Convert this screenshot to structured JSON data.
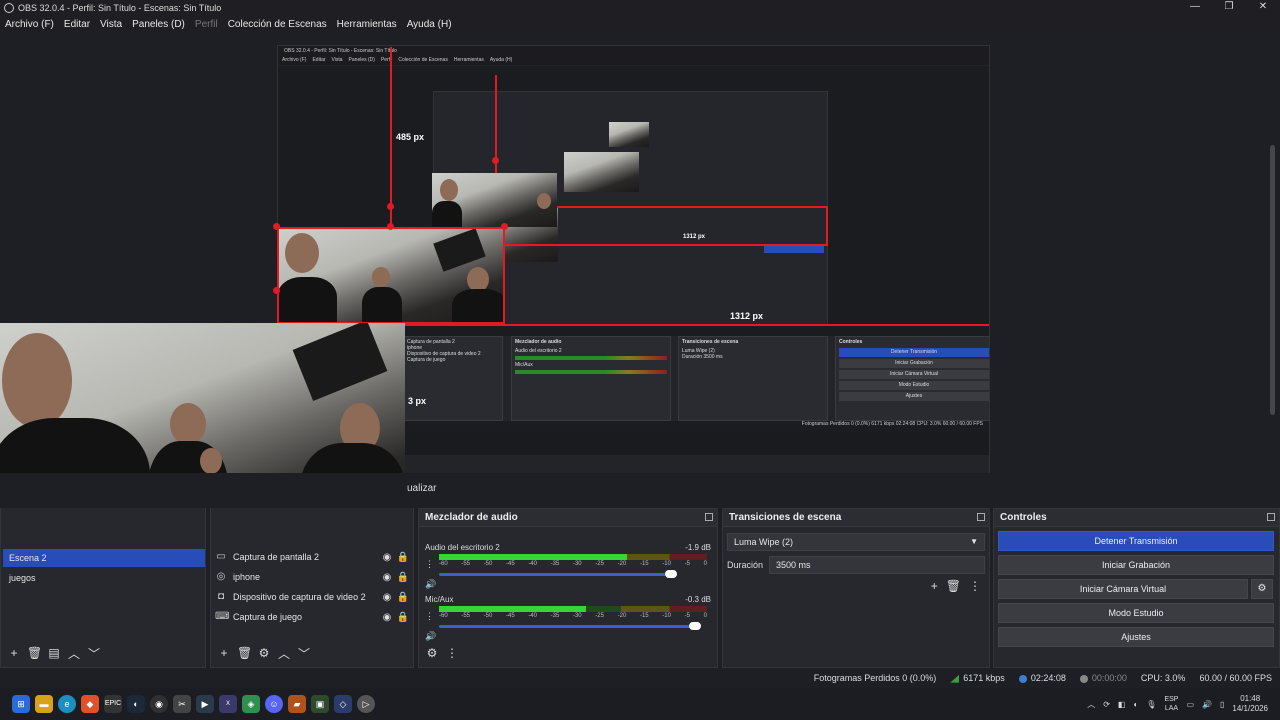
{
  "window": {
    "title": "OBS 32.0.4 - Perfil: Sin Título - Escenas: Sin Título",
    "minimize": "—",
    "maximize": "❐",
    "close": "✕"
  },
  "menu": {
    "archivo": "Archivo (F)",
    "editar": "Editar",
    "vista": "Vista",
    "paneles": "Paneles (D)",
    "perfil": "Perfil",
    "coleccion": "Colección de Escenas",
    "herramientas": "Herramientas",
    "ayuda": "Ayuda (H)"
  },
  "preview": {
    "height_label": "485 px",
    "width_label": "1312 px",
    "width_label_2": "1312 px",
    "partial_label": "3 px",
    "actualizar": "ualizar"
  },
  "nested": {
    "title": "OBS 32.0.4 - Perfil: Sin Título - Escenas: Sin Título",
    "menu": [
      "Archivo (F)",
      "Editar",
      "Vista",
      "Paneles (D)",
      "Perfil",
      "Colección de Escenas",
      "Herramientas",
      "Ayuda (H)"
    ],
    "sources": [
      "Captura de pantalla 2",
      "iphone",
      "Dispositivo de captura de video 2",
      "Captura de juego"
    ],
    "mixer_title": "Mezclador de audio",
    "mixer_ch1": "Audio del escritorio 2",
    "mixer_ch2": "Mic/Aux",
    "trans_title": "Transiciones de escena",
    "trans_value": "Luma Wipe (2)",
    "trans_dur_label": "Duración",
    "trans_dur": "3500 ms",
    "ctrl_title": "Controles",
    "ctrl_buttons": [
      "Detener Transmisión",
      "Iniciar Grabación",
      "Iniciar Cámara Virtual",
      "Modo Estudio",
      "Ajustes"
    ],
    "status": "Fotogramas Perdidos 0 (0.0%)   6171 kbps   02:24:08   CPU: 3.0%   60.00 / 60.00 FPS"
  },
  "scenes": {
    "items": [
      "Escena 2",
      "juegos"
    ],
    "selected": "Escena 2"
  },
  "sources": {
    "items": [
      {
        "name": "Captura de pantalla 2",
        "icon": "monitor-icon"
      },
      {
        "name": "iphone",
        "icon": "camera-icon"
      },
      {
        "name": "Dispositivo de captura de video 2",
        "icon": "camera-icon"
      },
      {
        "name": "Captura de juego",
        "icon": "gamepad-icon"
      }
    ]
  },
  "mixer": {
    "title": "Mezclador de audio",
    "channels": [
      {
        "name": "Audio del escritorio 2",
        "db": "-1.9 dB",
        "level": 0.7,
        "volume": 0.88
      },
      {
        "name": "Mic/Aux",
        "db": "-0.3 dB",
        "level": 0.55,
        "volume": 0.97
      }
    ],
    "ticks": [
      "-60",
      "-55",
      "-50",
      "-45",
      "-40",
      "-35",
      "-30",
      "-25",
      "-20",
      "-15",
      "-10",
      "-5",
      "0"
    ]
  },
  "transitions": {
    "title": "Transiciones de escena",
    "selected": "Luma Wipe (2)",
    "duration_label": "Duración",
    "duration_value": "3500 ms"
  },
  "controls": {
    "title": "Controles",
    "stop_stream": "Detener Transmisión",
    "start_record": "Iniciar Grabación",
    "start_vcam": "Iniciar Cámara Virtual",
    "studio_mode": "Modo Estudio",
    "settings": "Ajustes"
  },
  "status": {
    "dropped": "Fotogramas Perdidos 0 (0.0%)",
    "bitrate": "6171 kbps",
    "stream_time": "02:24:08",
    "record_time": "00:00:00",
    "cpu": "CPU: 3.0%",
    "fps": "60.00 / 60.00 FPS"
  },
  "taskbar": {
    "lang_top": "ESP",
    "lang_bottom": "LAA",
    "time": "01:48",
    "date": "14/1/2026"
  },
  "colors": {
    "accent": "#284cb8",
    "selection": "#e01b24",
    "meter_green": "#37d337"
  }
}
